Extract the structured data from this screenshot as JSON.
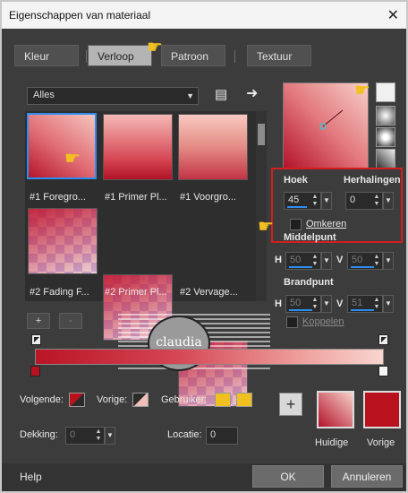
{
  "window": {
    "title": "Eigenschappen van materiaal",
    "close_glyph": "✕"
  },
  "tabs": [
    {
      "label": "Kleur"
    },
    {
      "label": "Verloop"
    },
    {
      "label": "Patroon"
    },
    {
      "label": "Textuur"
    }
  ],
  "active_tab": "Verloop",
  "category": {
    "value": "Alles"
  },
  "gradients": [
    {
      "label": "#1 Foregro..."
    },
    {
      "label": "#1 Primer Pl..."
    },
    {
      "label": "#1 Voorgro..."
    },
    {
      "label": "#2 Fading F..."
    },
    {
      "label": "#2 Primer Pl..."
    },
    {
      "label": "#2 Vervage..."
    }
  ],
  "list_buttons": {
    "add": "+",
    "remove": "-"
  },
  "settings": {
    "hoek_label": "Hoek",
    "hoek_value": "45",
    "herhalingen_label": "Herhalingen",
    "herhalingen_value": "0",
    "omkeren_label": "Omkeren",
    "middelpunt_label": "Middelpunt",
    "middelpunt_h_label": "H",
    "middelpunt_h_value": "50",
    "middelpunt_v_label": "V",
    "middelpunt_v_value": "50",
    "brandpunt_label": "Brandpunt",
    "brandpunt_h_label": "H",
    "brandpunt_h_value": "50",
    "brandpunt_v_label": "V",
    "brandpunt_v_value": "51",
    "koppelen_label": "Koppelen"
  },
  "colors": {
    "volgende_label": "Volgende:",
    "vorige_label": "Vorige:",
    "gebruiker_label": "Gebruiker:",
    "dekking_label": "Dekking:",
    "dekking_value": "0",
    "locatie_label": "Locatie:",
    "locatie_value": "0",
    "huidige_label": "Huidige",
    "vorige_swatch_label": "Vorige",
    "accent": "#2e8df0",
    "primary": "#b8121f",
    "user_color": "#f0c020"
  },
  "watermark": {
    "text": "claudia"
  },
  "footer": {
    "help": "Help",
    "ok": "OK",
    "cancel": "Annuleren"
  }
}
